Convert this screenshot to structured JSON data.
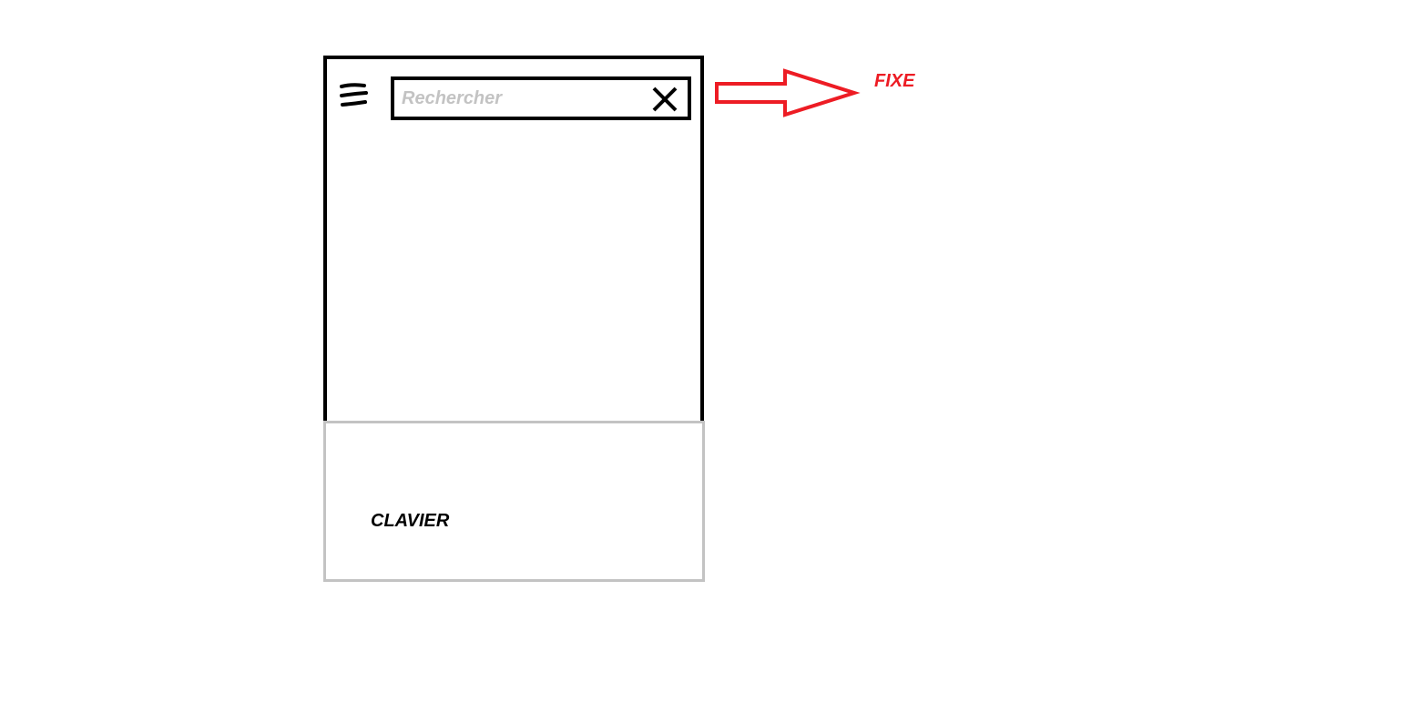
{
  "search": {
    "placeholder": "Rechercher"
  },
  "keyboard": {
    "label": "CLAVIER"
  },
  "annotation": {
    "label": "FIXE",
    "color": "#ed1c24"
  },
  "icons": {
    "menu": "hamburger-menu-icon",
    "clear": "close-icon",
    "annotation_arrow": "right-arrow-icon"
  },
  "colors": {
    "frame": "#000000",
    "keyboard_border": "#c3c3c3",
    "placeholder": "#c3c3c3",
    "annotation": "#ed1c24"
  }
}
